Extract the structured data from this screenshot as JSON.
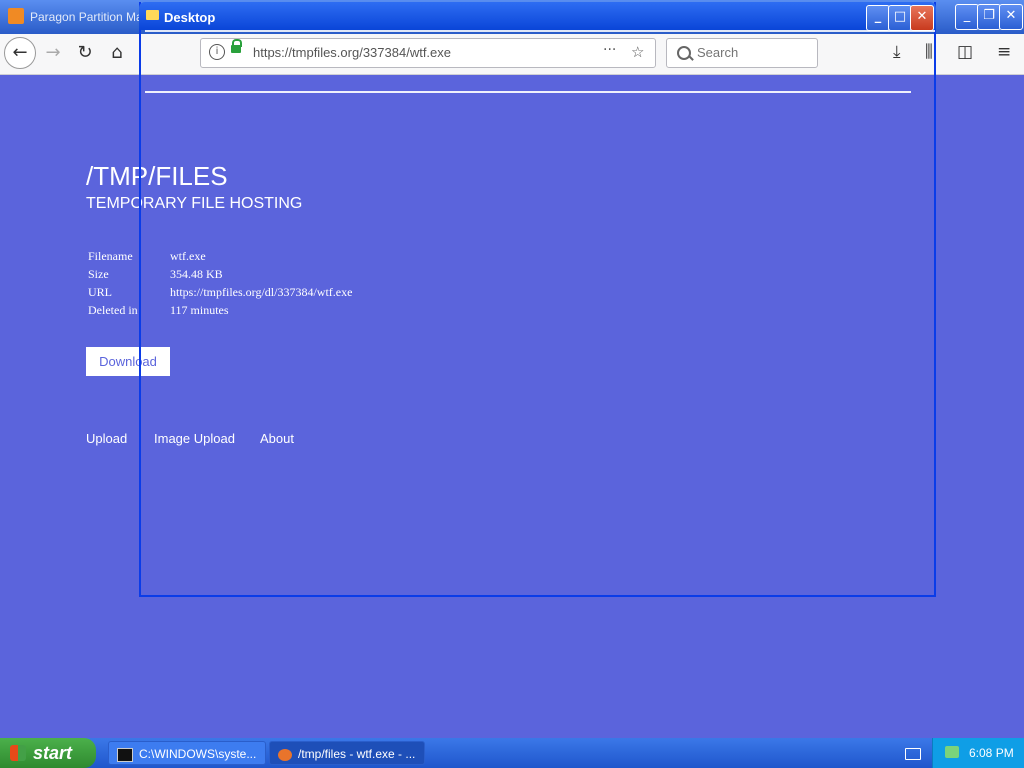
{
  "firefox": {
    "window_title": "Paragon Partition Mana",
    "url": "https://tmpfiles.org/337384/wtf.exe",
    "search_placeholder": "Search"
  },
  "page": {
    "title": "/TMP/FILES",
    "subtitle": "TEMPORARY FILE HOSTING",
    "file_info": [
      {
        "label": "Filename",
        "value": "wtf.exe"
      },
      {
        "label": "Size",
        "value": "354.48 KB"
      },
      {
        "label": "URL",
        "value": "https://tmpfiles.org/dl/337384/wtf.exe"
      },
      {
        "label": "Deleted in",
        "value": "117 minutes"
      }
    ],
    "download_label": "Download",
    "footer_links": [
      "Upload",
      "Image Upload",
      "About"
    ]
  },
  "desktop_window": {
    "title": "Desktop"
  },
  "taskbar": {
    "start_label": "start",
    "items": [
      {
        "label": "C:\\WINDOWS\\syste...",
        "icon": "cmd-icon"
      },
      {
        "label": "/tmp/files - wtf.exe - ...",
        "icon": "firefox-icon"
      }
    ],
    "clock": "6:08 PM"
  },
  "colors": {
    "page_background": "#5b64dc",
    "window_blue": "#0a45d8",
    "start_green": "#2f8a2f"
  }
}
